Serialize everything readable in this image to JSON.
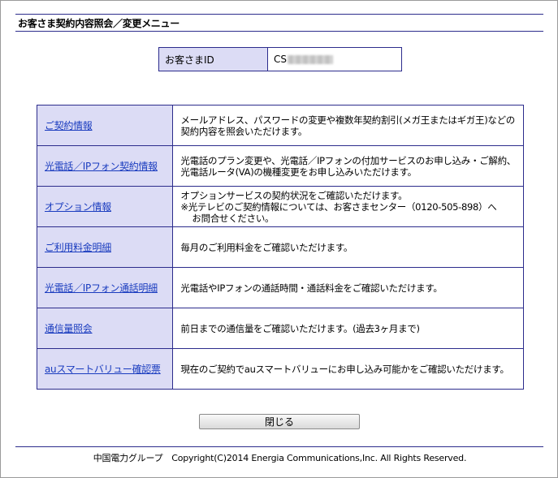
{
  "page": {
    "title": "お客さま契約内容照会／変更メニュー"
  },
  "customer": {
    "id_label": "お客さまID",
    "id_value": "CS"
  },
  "menu": [
    {
      "link": "ご契約情報",
      "desc": [
        "メールアドレス、パスワードの変更や複数年契約割引(メガ王またはギガ王)などの",
        "契約内容を照会いただけます。"
      ]
    },
    {
      "link": "光電話／IPフォン契約情報",
      "desc": [
        "光電話のプラン変更や、光電話／IPフォンの付加サービスのお申し込み・ご解約、",
        "光電話ルータ(VA)の機種変更をお申し込みいただけます。"
      ]
    },
    {
      "link": "オプション情報",
      "desc": [
        "オプションサービスの契約状況をご確認いただけます。",
        "※光テレビのご契約情報については、お客さまセンター（0120-505-898）へ",
        "お問合せください。"
      ]
    },
    {
      "link": "ご利用料金明細",
      "desc": [
        "毎月のご利用料金をご確認いただけます。"
      ]
    },
    {
      "link": "光電話／IPフォン通話明細",
      "desc": [
        "光電話やIPフォンの通話時間・通話料金をご確認いただけます。"
      ]
    },
    {
      "link": "通信量照会",
      "desc": [
        "前日までの通信量をご確認いただけます。(過去3ヶ月まで)"
      ]
    },
    {
      "link": "auスマートバリュー確認票",
      "desc": [
        "現在のご契約でauスマートバリューにお申し込み可能かをご確認いただけます。"
      ]
    }
  ],
  "buttons": {
    "close_label": "閉じる"
  },
  "footer": {
    "text": "中国電力グループ　Copyright(C)2014 Energia Communications,Inc. All Rights Reserved."
  },
  "colors": {
    "border": "#2c2c8c",
    "label_bg": "#dcdcf5",
    "link": "#1a3cbf"
  }
}
